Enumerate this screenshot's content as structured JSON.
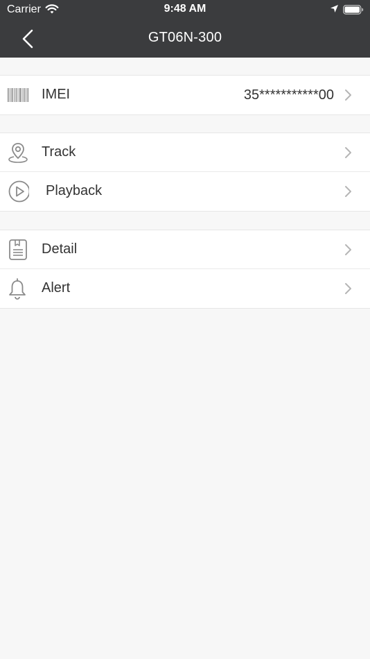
{
  "status_bar": {
    "carrier": "Carrier",
    "time": "9:48 AM"
  },
  "nav": {
    "title": "GT06N-300",
    "back_icon": "chevron-left-icon"
  },
  "groups": [
    {
      "rows": [
        {
          "label": "IMEI",
          "value": "35***********00",
          "icon": "barcode-icon"
        }
      ]
    },
    {
      "rows": [
        {
          "label": "Track",
          "icon": "map-pin-icon"
        },
        {
          "label": "Playback",
          "icon": "play-circle-icon"
        }
      ]
    },
    {
      "rows": [
        {
          "label": "Detail",
          "icon": "document-icon"
        },
        {
          "label": "Alert",
          "icon": "bell-icon"
        }
      ]
    }
  ],
  "colors": {
    "header_bg": "#3b3c3e",
    "page_bg": "#f7f7f7",
    "row_bg": "#ffffff",
    "icon_gray": "#8a8a8a",
    "chevron_gray": "#b5b5b5"
  }
}
